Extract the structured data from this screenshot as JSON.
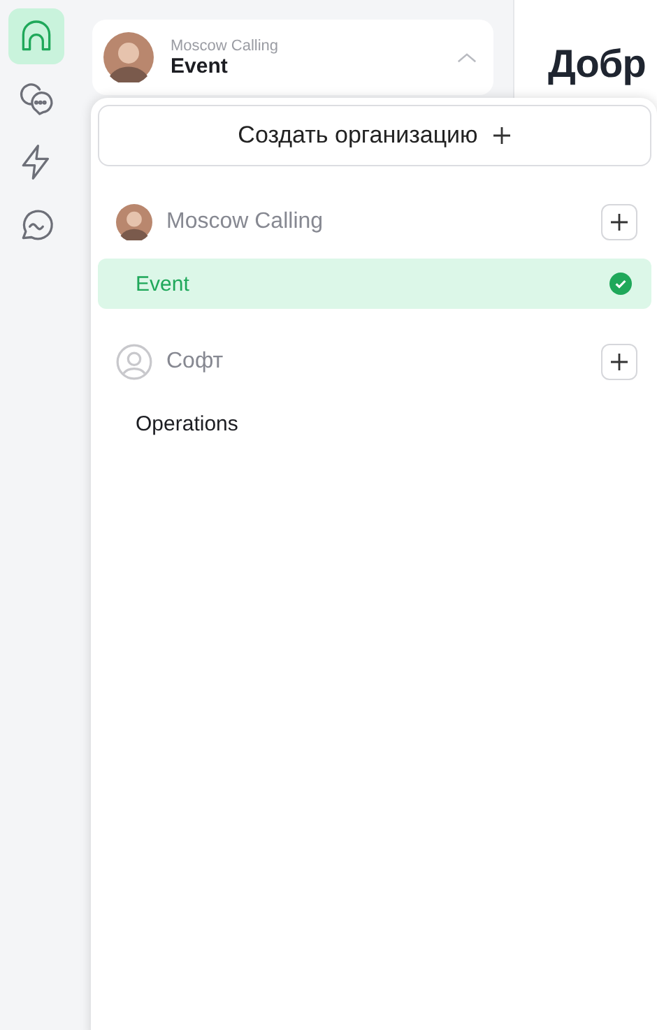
{
  "rail": [
    {
      "kind": "home",
      "selected": true
    },
    {
      "kind": "chats",
      "selected": false
    },
    {
      "kind": "bolt",
      "selected": false
    },
    {
      "kind": "wave",
      "selected": false
    }
  ],
  "switcher": {
    "organization": "Moscow Calling",
    "workspace": "Event",
    "expanded": true,
    "avatar": {
      "kind": "photo"
    }
  },
  "heading": "Добр",
  "menu": {
    "create_button": "Создать организацию",
    "organizations": [
      {
        "name": "Moscow Calling",
        "avatar": {
          "kind": "photo"
        },
        "workspaces": [
          {
            "name": "Event",
            "selected": true
          }
        ]
      },
      {
        "name": "Софт",
        "avatar": {
          "kind": "placeholder"
        },
        "workspaces": [
          {
            "name": "Operations",
            "selected": false
          }
        ]
      }
    ]
  }
}
